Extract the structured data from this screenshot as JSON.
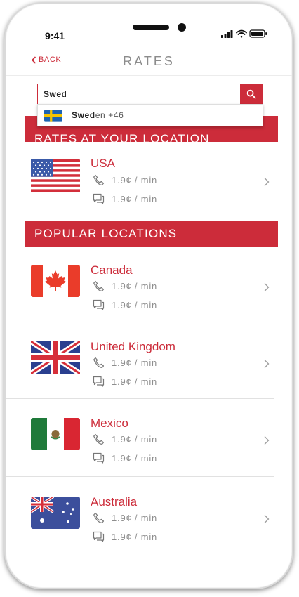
{
  "status_bar": {
    "time": "9:41"
  },
  "nav": {
    "back_label": "BACK",
    "title": "RATES"
  },
  "search": {
    "value": "Swed"
  },
  "suggestion": {
    "match": "Swed",
    "rest": "en",
    "code": "+46",
    "flag_icon": "sweden-flag-icon"
  },
  "sections": {
    "your_location": "RATES AT YOUR LOCATION",
    "popular": "POPULAR LOCATIONS"
  },
  "your_location": {
    "name": "USA",
    "call_rate": "1.9¢ / min",
    "sms_rate": "1.9¢ / min",
    "flag_icon": "usa-flag-icon"
  },
  "popular": [
    {
      "name": "Canada",
      "call_rate": "1.9¢ / min",
      "sms_rate": "1.9¢ / min",
      "flag_icon": "canada-flag-icon"
    },
    {
      "name": "United Kingdom",
      "call_rate": "1.9¢ / min",
      "sms_rate": "1.9¢ / min",
      "flag_icon": "uk-flag-icon"
    },
    {
      "name": "Mexico",
      "call_rate": "1.9¢ / min",
      "sms_rate": "1.9¢ / min",
      "flag_icon": "mexico-flag-icon"
    },
    {
      "name": "Australia",
      "call_rate": "1.9¢ / min",
      "sms_rate": "1.9¢ / min",
      "flag_icon": "australia-flag-icon"
    }
  ],
  "colors": {
    "accent": "#cc2c3a",
    "muted_text": "#8e8e8e",
    "title_text": "#8c8c8c"
  }
}
